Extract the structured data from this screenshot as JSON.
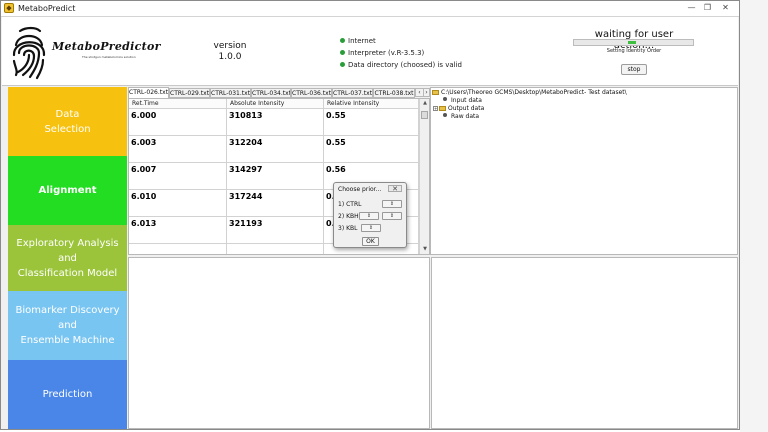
{
  "window": {
    "title": "MetaboPredict",
    "minimize_glyph": "—",
    "restore_glyph": "❐",
    "close_glyph": "✕"
  },
  "header": {
    "logo_text": "MetaboPredictor",
    "logo_tagline": "The shotgun metabolomics solution",
    "version_label": "version",
    "version_value": "1.0.0",
    "status": [
      "Internet",
      "Interpreter (v.R-3.5.3)",
      "Data directory (choosed) is valid"
    ],
    "status_color": "#2a9d3a",
    "waiting_text": "waiting for user action...",
    "progress_activity": "indeterminate",
    "progress_fill_color": "#3fbf3f",
    "subtask_text": "Setting Identity Order",
    "stop_label": "stop"
  },
  "nav": {
    "items": [
      {
        "label_lines": [
          "Data",
          "Selection"
        ],
        "bg": "#f7c20f",
        "fg": "#ffffff",
        "weight": "normal"
      },
      {
        "label_lines": [
          "Alignment"
        ],
        "bg": "#22dd22",
        "fg": "#ffffff",
        "weight": "bold"
      },
      {
        "label_lines": [
          "Exploratory Analysis",
          "and",
          "Classification Model"
        ],
        "bg": "#9bc43b",
        "fg": "#ffffff",
        "weight": "normal"
      },
      {
        "label_lines": [
          "Biomarker Discovery",
          "and",
          "Ensemble Machine"
        ],
        "bg": "#79c5f2",
        "fg": "#ffffff",
        "weight": "normal"
      },
      {
        "label_lines": [
          "Prediction"
        ],
        "bg": "#4a86e8",
        "fg": "#ffffff",
        "weight": "normal"
      }
    ]
  },
  "file_tabs": {
    "tabs": [
      "CTRL-026.txt",
      "CTRL-029.txt",
      "CTRL-031.txt",
      "CTRL-034.txt",
      "CTRL-036.txt",
      "CTRL-037.txt",
      "CTRL-038.txt"
    ],
    "active": 0,
    "scroll_left": "‹",
    "scroll_right": "›"
  },
  "table": {
    "columns": [
      "Ret.Time",
      "Absolute Intensity",
      "Relative Intensity"
    ],
    "rows": [
      [
        "6.000",
        "310813",
        "0.55"
      ],
      [
        "6.003",
        "312204",
        "0.55"
      ],
      [
        "6.007",
        "314297",
        "0.56"
      ],
      [
        "6.010",
        "317244",
        "0.56"
      ],
      [
        "6.013",
        "321193",
        "0.57"
      ]
    ],
    "scroll_up": "▲",
    "scroll_down": "▼"
  },
  "tree": {
    "root": "C:\\Users\\Theoreo GCMS\\Desktop\\MetaboPredict- Test dataset\\",
    "children": [
      {
        "label": "Input data",
        "kind": "leaf"
      },
      {
        "label": "Output data",
        "kind": "folder",
        "expander": "+"
      },
      {
        "label": "Raw data",
        "kind": "leaf"
      }
    ]
  },
  "dialog": {
    "title": "Choose prior...",
    "close_glyph": "✕",
    "rows": [
      {
        "index": "1)",
        "name": "CTRL",
        "spinner": "⇕"
      },
      {
        "index": "2)",
        "name": "KBH",
        "spinner": "⇕",
        "spinner2": "⇕"
      },
      {
        "index": "3)",
        "name": "KBL",
        "spinner": "⇕"
      }
    ],
    "ok_label": "OK"
  }
}
